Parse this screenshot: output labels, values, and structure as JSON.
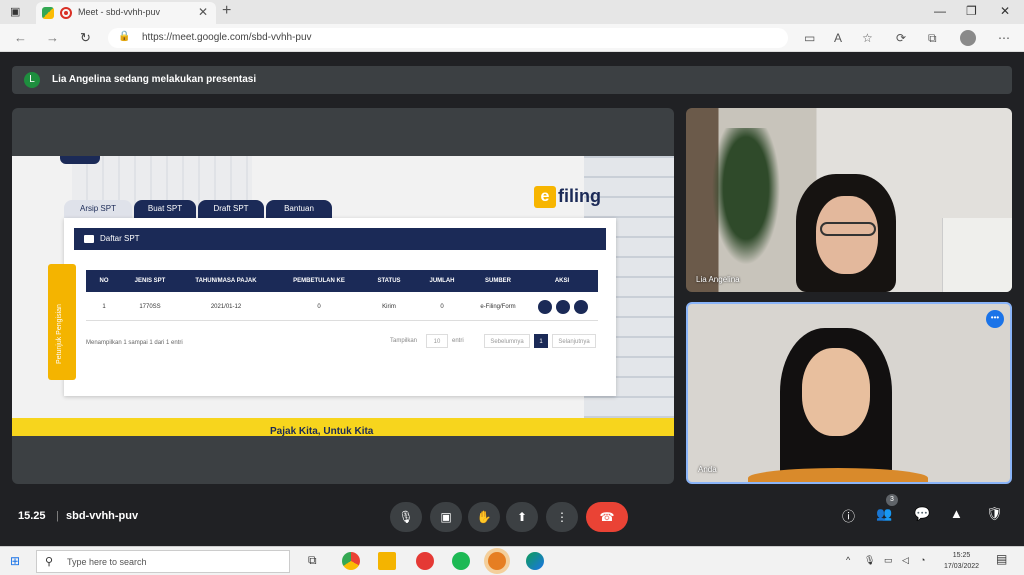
{
  "browser": {
    "tab_title": "Meet - sbd-vvhh-puv",
    "url": "https://meet.google.com/sbd-vvhh-puv"
  },
  "meet": {
    "banner_text": "Lia Angelina sedang melakukan presentasi",
    "banner_avatar": "L",
    "meeting_time": "15.25",
    "meeting_code": "sbd-vvhh-puv",
    "participant_count": "3",
    "tiles": [
      {
        "name": "Lia Angelina"
      },
      {
        "name": "Anda"
      }
    ]
  },
  "slide": {
    "logo_e": "e",
    "logo_text": "filing",
    "tabs": [
      "Arsip SPT",
      "Buat SPT",
      "Draft SPT",
      "Bantuan"
    ],
    "panel_title": "Daftar SPT",
    "side_tab": "Petunjuk Pengisian",
    "columns": [
      "NO",
      "JENIS SPT",
      "TAHUN/MASA PAJAK",
      "PEMBETULAN KE",
      "STATUS",
      "JUMLAH",
      "SUMBER",
      "AKSI"
    ],
    "rows": [
      [
        "1",
        "1770SS",
        "2021/01-12",
        "0",
        "Kirim",
        "0",
        "e-Filing/Form",
        ""
      ]
    ],
    "info": "Menampilkan 1 sampai 1 dari 1 entri",
    "pager_label": "Tampilkan",
    "pager_count": "10",
    "pager_unit": "entri",
    "pager_prev": "Sebelumnya",
    "pager_page": "1",
    "pager_next": "Selanjutnya",
    "slogan": "Pajak Kita, Untuk Kita"
  },
  "taskbar": {
    "search_placeholder": "Type here to search",
    "time": "15:25",
    "date": "17/03/2022"
  },
  "colors": {
    "navy": "#1b2a57",
    "yellow": "#f7d51d",
    "end_call": "#ea4335",
    "self_border": "#8ab4f8"
  }
}
